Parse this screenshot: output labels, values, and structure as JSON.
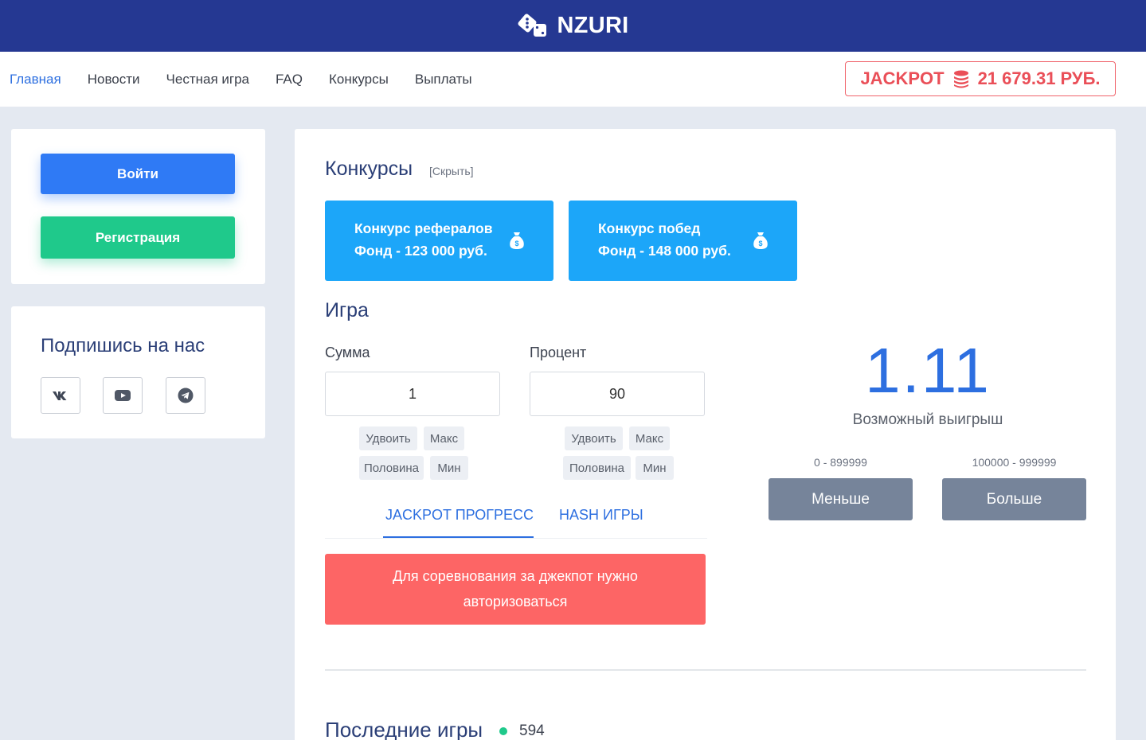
{
  "brand": {
    "name": "NZURI",
    "color": "#253892",
    "logo_icon": "dice-icon"
  },
  "nav": {
    "items": [
      {
        "label": "Главная",
        "active": true
      },
      {
        "label": "Новости",
        "active": false
      },
      {
        "label": "Честная игра",
        "active": false
      },
      {
        "label": "FAQ",
        "active": false
      },
      {
        "label": "Конкурсы",
        "active": false
      },
      {
        "label": "Выплаты",
        "active": false
      }
    ],
    "jackpot": {
      "label": "JACKPOT",
      "amount": "21 679.31 РУБ.",
      "icon": "coins-icon",
      "color": "#ea4f58"
    }
  },
  "auth": {
    "login": "Войти",
    "register": "Регистрация"
  },
  "social": {
    "title": "Подпишись на нас",
    "icons": [
      "vk-icon",
      "youtube-icon",
      "telegram-icon"
    ]
  },
  "contests": {
    "title": "Конкурсы",
    "hide": "[Скрыть]",
    "items": [
      {
        "line1": "Конкурс рефералов",
        "line2": "Фонд - 123 000 руб.",
        "icon": "money-bag-icon"
      },
      {
        "line1": "Конкурс побед",
        "line2": "Фонд - 148 000 руб.",
        "icon": "money-bag-icon"
      }
    ]
  },
  "game": {
    "title": "Игра",
    "amount": {
      "label": "Сумма",
      "value": "1"
    },
    "percent": {
      "label": "Процент",
      "value": "90"
    },
    "chips": {
      "double": "Удвоить",
      "max": "Макс",
      "half": "Половина",
      "min": "Мин"
    },
    "multiplier": "1.11",
    "win_label": "Возможный выигрыш",
    "less": {
      "range": "0 - 899999",
      "label": "Меньше"
    },
    "more": {
      "range": "100000 - 999999",
      "label": "Больше"
    },
    "tabs": [
      "JACKPOT ПРОГРЕСС",
      "HASH ИГРЫ"
    ],
    "alert": {
      "line1": "Для соревнования за джекпот нужно",
      "line2": "авторизоваться"
    }
  },
  "last_games": {
    "title": "Последние игры",
    "online": "594"
  }
}
